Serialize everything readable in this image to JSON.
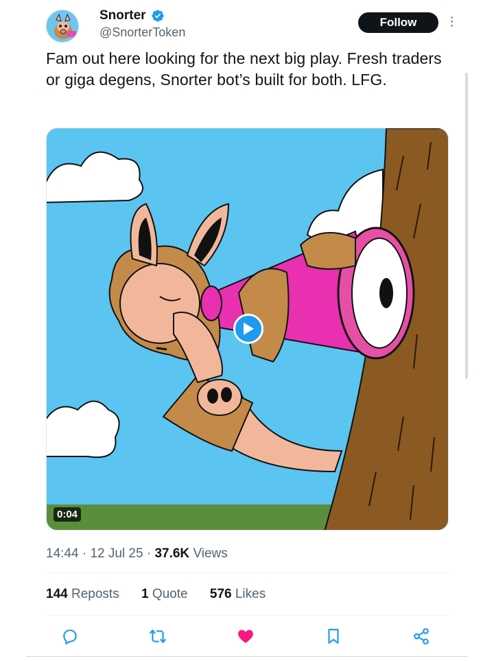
{
  "author": {
    "display_name": "Snorter",
    "handle": "@SnorterToken",
    "verified": true,
    "avatar_icon": "snorter-mascot-avatar"
  },
  "follow_label": "Follow",
  "tweet_text": "Fam out here looking for the next big play. Fresh traders or giga degens, Snorter bot’s built for both. LFG.",
  "media": {
    "type": "video",
    "duration": "0:04",
    "description_icon": "cartoon-aardvark-with-pink-telescope"
  },
  "meta": {
    "time": "14:44",
    "date": "12 Jul 25",
    "views_count": "37.6K",
    "views_label": "Views"
  },
  "stats": {
    "reposts_count": "144",
    "reposts_label": "Reposts",
    "quotes_count": "1",
    "quotes_label": "Quote",
    "likes_count": "576",
    "likes_label": "Likes"
  },
  "actions": [
    "reply-icon",
    "repost-icon",
    "like-icon",
    "bookmark-icon",
    "share-icon"
  ],
  "colors": {
    "accent": "#1d9bf0",
    "like": "#f91880",
    "text": "#0f1419",
    "secondary": "#536471"
  }
}
